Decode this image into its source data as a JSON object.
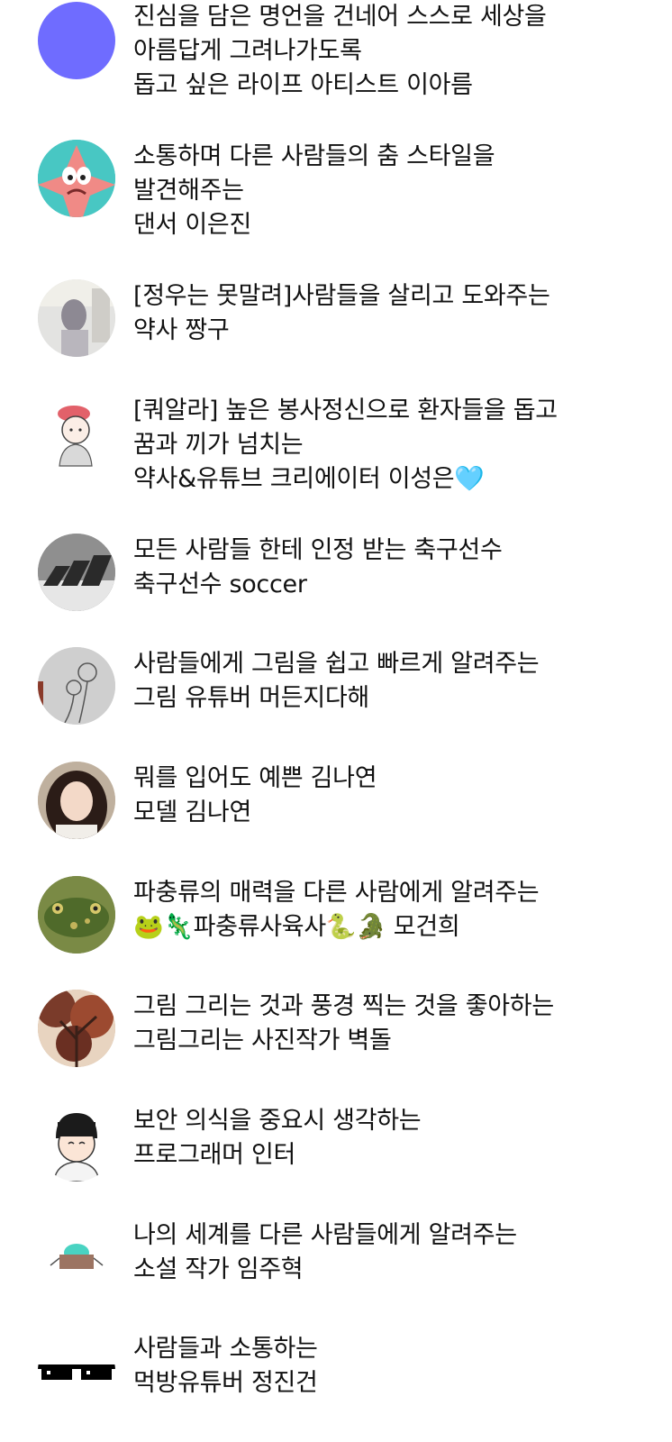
{
  "colors": {
    "avatar_purple": "#6f6cff",
    "text": "#111111",
    "background": "#ffffff"
  },
  "profiles": [
    {
      "avatar": "solid-purple-avatar",
      "lines": [
        "진심을 담은 명언을 건네어 스스로 세상을",
        "아름답게 그려나가도록",
        "돕고 싶은 라이프 아티스트 이아름"
      ]
    },
    {
      "avatar": "starfish-cartoon-avatar",
      "lines": [
        "소통하며 다른 사람들의 춤 스타일을",
        "발견해주는",
        "댄서 이은진"
      ]
    },
    {
      "avatar": "mirror-selfie-avatar",
      "lines": [
        "[정우는 못말려]사람들을 살리고 도와주는",
        "약사 짱구"
      ]
    },
    {
      "avatar": "beret-character-avatar",
      "lines": [
        "[쿼알라] 높은 봉사정신으로 환자들을 돕고",
        "꿈과 끼가 넘치는",
        "약사&유튜브 크리에이터 이성은🩵"
      ]
    },
    {
      "avatar": "stripes-logo-avatar",
      "lines": [
        "모든 사람들 한테 인정 받는 축구선수",
        "축구선수 soccer"
      ]
    },
    {
      "avatar": "flower-sketch-avatar",
      "lines": [
        "사람들에게 그림을 쉽고 빠르게 알려주는",
        "그림 유튜버 머든지다해"
      ]
    },
    {
      "avatar": "woman-portrait-avatar",
      "lines": [
        "뭐를 입어도 예쁜 김나연",
        "모델 김나연"
      ]
    },
    {
      "avatar": "frog-photo-avatar",
      "lines": [
        "파충류의 매력을 다른 사람에게 알려주는",
        "🐸🦎파충류사육사🐍🐊 모건희"
      ]
    },
    {
      "avatar": "autumn-tree-avatar",
      "lines": [
        "그림 그리는 것과 풍경 찍는 것을 좋아하는",
        "그림그리는 사진작가 벽돌"
      ]
    },
    {
      "avatar": "boy-cartoon-avatar",
      "lines": [
        "보안 의식을 중요시 생각하는",
        "프로그래머 인터"
      ]
    },
    {
      "avatar": "box-robot-avatar",
      "lines": [
        "나의 세계를 다른 사람들에게 알려주는",
        "소설 작가 임주혁"
      ]
    },
    {
      "avatar": "pixel-sunglasses-avatar",
      "lines": [
        "사람들과 소통하는",
        "먹방유튜버 정진건"
      ]
    }
  ]
}
